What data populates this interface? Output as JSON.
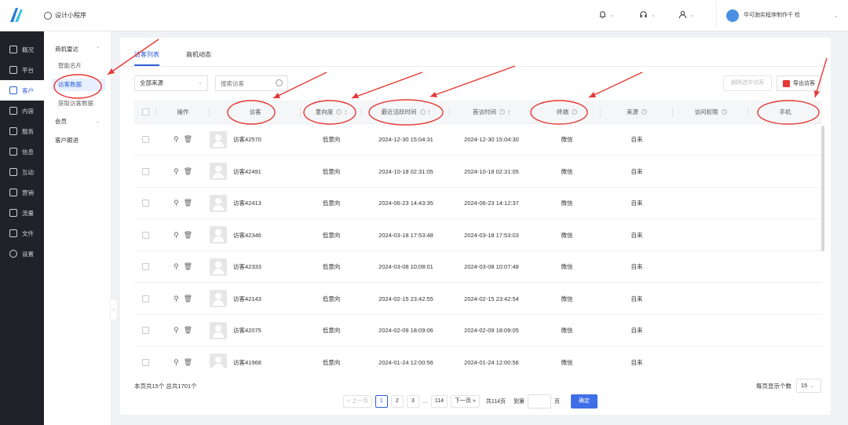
{
  "header": {
    "app_title": "设计小程序",
    "user_name": "华可驰实程序制作千 检",
    "icons": [
      "bell-icon",
      "headset-icon",
      "user-icon"
    ]
  },
  "nav": [
    {
      "label": "概况",
      "icon": "chart-icon"
    },
    {
      "label": "平台",
      "icon": "layers-icon"
    },
    {
      "label": "客户",
      "icon": "customer-icon",
      "active": true
    },
    {
      "label": "内容",
      "icon": "content-icon"
    },
    {
      "label": "服务",
      "icon": "service-icon"
    },
    {
      "label": "信息",
      "icon": "message-icon"
    },
    {
      "label": "互动",
      "icon": "interact-icon"
    },
    {
      "label": "营销",
      "icon": "tag-icon"
    },
    {
      "label": "流量",
      "icon": "traffic-icon"
    },
    {
      "label": "文件",
      "icon": "folder-icon"
    },
    {
      "label": "设置",
      "icon": "gear-icon"
    }
  ],
  "subnav": {
    "group1": "商机雷达",
    "item1": "智能名片",
    "item2": "访客数据",
    "item3": "获取访客数据",
    "group2": "会员",
    "group3": "客户跟进"
  },
  "tabs": [
    "访客列表",
    "商机动态"
  ],
  "toolbar": {
    "source_select": "全部来源",
    "search_placeholder": "搜索访客",
    "delete_btn": "删除选中访客",
    "export_btn": "导出访客"
  },
  "columns": {
    "ops": "操作",
    "visitor": "访客",
    "intent": "意向度",
    "last_active": "最近活跃时间",
    "first_visit": "首访时间",
    "channel": "终端",
    "source": "来源",
    "permission": "访问权限",
    "phone": "手机"
  },
  "rows": [
    {
      "visitor": "访客42570",
      "intent": "低意向",
      "last_active": "2024-12-30 15:04:31",
      "first_visit": "2024-12-30 15:04:30",
      "channel": "微信",
      "source": "自来"
    },
    {
      "visitor": "访客42491",
      "intent": "低意向",
      "last_active": "2024-10-18 02:31:05",
      "first_visit": "2024-10-18 02:31:05",
      "channel": "微信",
      "source": "自来"
    },
    {
      "visitor": "访客42413",
      "intent": "低意向",
      "last_active": "2024-06-23 14:43:35",
      "first_visit": "2024-06-23 14:12:37",
      "channel": "微信",
      "source": "自来"
    },
    {
      "visitor": "访客42346",
      "intent": "低意向",
      "last_active": "2024-03-18 17:53:48",
      "first_visit": "2024-03-18 17:53:03",
      "channel": "微信",
      "source": "自来"
    },
    {
      "visitor": "访客42333",
      "intent": "低意向",
      "last_active": "2024-03-08 10:08:01",
      "first_visit": "2024-03-08 10:07:48",
      "channel": "微信",
      "source": "自来"
    },
    {
      "visitor": "访客42143",
      "intent": "低意向",
      "last_active": "2024-02-15 23:42:55",
      "first_visit": "2024-02-15 23:42:54",
      "channel": "微信",
      "source": "自来"
    },
    {
      "visitor": "访客42075",
      "intent": "低意向",
      "last_active": "2024-02-09 18:09:06",
      "first_visit": "2024-02-09 18:09:05",
      "channel": "微信",
      "source": "自来"
    },
    {
      "visitor": "访客41968",
      "intent": "低意向",
      "last_active": "2024-01-24 12:00:56",
      "first_visit": "2024-01-24 12:00:56",
      "channel": "微信",
      "source": "自来"
    }
  ],
  "footer": {
    "summary": "本页共15个 总共1701个",
    "prev": "« 上一页",
    "pages": [
      "1",
      "2",
      "3",
      "…",
      "114"
    ],
    "next": "下一页 »",
    "total_pages": "共114页",
    "goto": "到第",
    "page_unit": "页",
    "confirm": "确定",
    "per_page_label": "每页显示个数",
    "per_page_value": "15"
  },
  "colors": {
    "accent": "#2b5fd9",
    "sidebar_bg": "#1f2329",
    "annotation": "#e53935"
  }
}
